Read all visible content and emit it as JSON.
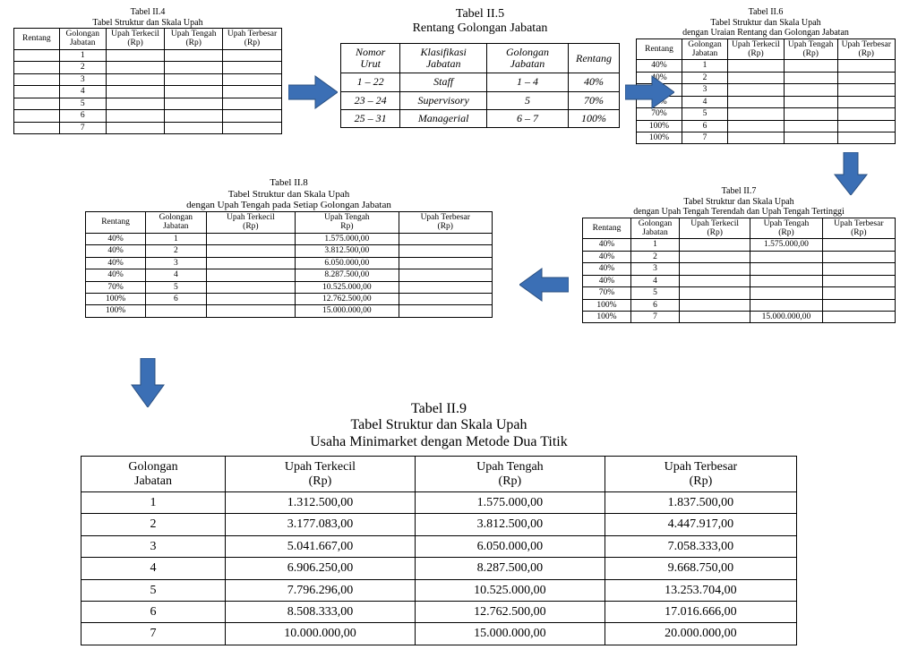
{
  "t4": {
    "title1": "Tabel II.4",
    "title2": "Tabel Struktur dan Skala Upah",
    "headers": [
      "Rentang",
      "Golongan\nJabatan",
      "Upah Terkecil\n(Rp)",
      "Upah Tengah\n(Rp)",
      "Upah Terbesar\n(Rp)"
    ],
    "rows": [
      [
        "",
        "1",
        "",
        "",
        ""
      ],
      [
        "",
        "2",
        "",
        "",
        ""
      ],
      [
        "",
        "3",
        "",
        "",
        ""
      ],
      [
        "",
        "4",
        "",
        "",
        ""
      ],
      [
        "",
        "5",
        "",
        "",
        ""
      ],
      [
        "",
        "6",
        "",
        "",
        ""
      ],
      [
        "",
        "7",
        "",
        "",
        ""
      ]
    ]
  },
  "t5": {
    "title1": "Tabel II.5",
    "title2": "Rentang Golongan Jabatan",
    "headers": [
      "Nomor Urut",
      "Klasifikasi Jabatan",
      "Golongan Jabatan",
      "Rentang"
    ],
    "rows": [
      [
        "1 – 22",
        "Staff",
        "1 – 4",
        "40%"
      ],
      [
        "23 – 24",
        "Supervisory",
        "5",
        "70%"
      ],
      [
        "25 – 31",
        "Managerial",
        "6 – 7",
        "100%"
      ]
    ]
  },
  "t6": {
    "title1": "Tabel II.6",
    "title2": "Tabel Struktur dan Skala Upah",
    "title3": "dengan Uraian Rentang dan Golongan Jabatan",
    "headers": [
      "Rentang",
      "Golongan\nJabatan",
      "Upah Terkecil\n(Rp)",
      "Upah Tengah\n(Rp)",
      "Upah Terbesar\n(Rp)"
    ],
    "rows": [
      [
        "40%",
        "1",
        "",
        "",
        ""
      ],
      [
        "40%",
        "2",
        "",
        "",
        ""
      ],
      [
        "40%",
        "3",
        "",
        "",
        ""
      ],
      [
        "40%",
        "4",
        "",
        "",
        ""
      ],
      [
        "70%",
        "5",
        "",
        "",
        ""
      ],
      [
        "100%",
        "6",
        "",
        "",
        ""
      ],
      [
        "100%",
        "7",
        "",
        "",
        ""
      ]
    ]
  },
  "t7": {
    "title1": "Tabel II.7",
    "title2": "Tabel Struktur dan Skala Upah",
    "title3": "dengan Upah Tengah Terendah dan Upah Tengah Tertinggi",
    "headers": [
      "Rentang",
      "Golongan\nJabatan",
      "Upah Terkecil\n(Rp)",
      "Upah Tengah\n(Rp)",
      "Upah Terbesar\n(Rp)"
    ],
    "rows": [
      [
        "40%",
        "1",
        "",
        "1.575.000,00",
        ""
      ],
      [
        "40%",
        "2",
        "",
        "",
        ""
      ],
      [
        "40%",
        "3",
        "",
        "",
        ""
      ],
      [
        "40%",
        "4",
        "",
        "",
        ""
      ],
      [
        "70%",
        "5",
        "",
        "",
        ""
      ],
      [
        "100%",
        "6",
        "",
        "",
        ""
      ],
      [
        "100%",
        "7",
        "",
        "15.000.000,00",
        ""
      ]
    ]
  },
  "t8": {
    "title1": "Tabel II.8",
    "title2": "Tabel Struktur dan Skala Upah",
    "title3": "dengan Upah Tengah pada Setiap Golongan Jabatan",
    "headers": [
      "Rentang",
      "Golongan\nJabatan",
      "Upah Terkecil\n(Rp)",
      "Upah Tengah\nRp)",
      "Upah Terbesar\n(Rp)"
    ],
    "rows": [
      [
        "40%",
        "1",
        "",
        "1.575.000,00",
        ""
      ],
      [
        "40%",
        "2",
        "",
        "3.812.500,00",
        ""
      ],
      [
        "40%",
        "3",
        "",
        "6.050.000,00",
        ""
      ],
      [
        "40%",
        "4",
        "",
        "8.287.500,00",
        ""
      ],
      [
        "70%",
        "5",
        "",
        "10.525.000,00",
        ""
      ],
      [
        "100%",
        "6",
        "",
        "12.762.500,00",
        ""
      ],
      [
        "100%",
        "",
        "",
        "15.000.000,00",
        ""
      ]
    ]
  },
  "t9": {
    "title1": "Tabel II.9",
    "title2": "Tabel Struktur dan Skala Upah",
    "title3": "Usaha Minimarket dengan Metode Dua Titik",
    "headers": [
      "Golongan\nJabatan",
      "Upah Terkecil\n(Rp)",
      "Upah Tengah\n(Rp)",
      "Upah Terbesar\n(Rp)"
    ],
    "rows": [
      [
        "1",
        "1.312.500,00",
        "1.575.000,00",
        "1.837.500,00"
      ],
      [
        "2",
        "3.177.083,00",
        "3.812.500,00",
        "4.447.917,00"
      ],
      [
        "3",
        "5.041.667,00",
        "6.050.000,00",
        "7.058.333,00"
      ],
      [
        "4",
        "6.906.250,00",
        "8.287.500,00",
        "9.668.750,00"
      ],
      [
        "5",
        "7.796.296,00",
        "10.525.000,00",
        "13.253.704,00"
      ],
      [
        "6",
        "8.508.333,00",
        "12.762.500,00",
        "17.016.666,00"
      ],
      [
        "7",
        "10.000.000,00",
        "15.000.000,00",
        "20.000.000,00"
      ]
    ]
  }
}
